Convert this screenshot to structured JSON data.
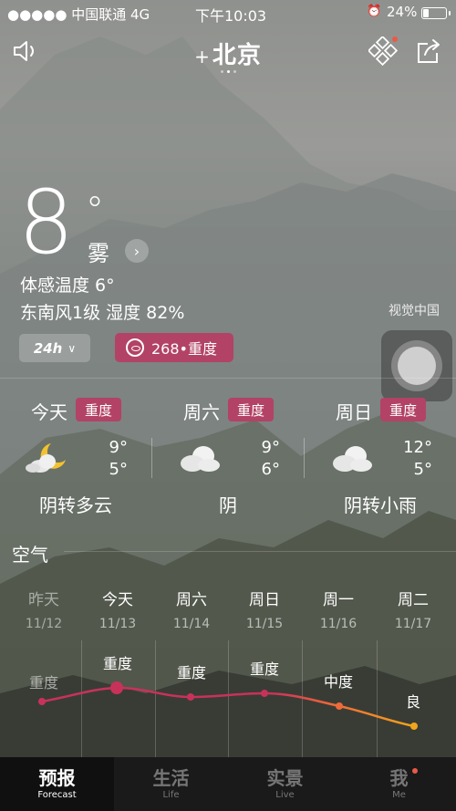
{
  "status_bar": {
    "carrier": "●●●●● 中国联通  4G",
    "time": "下午10:03",
    "alarm_icon": "alarm-icon",
    "battery_text": "24%",
    "battery_level": 0.24
  },
  "header": {
    "plus": "+",
    "city": "北京",
    "page_dots": 3,
    "active_dot": 1
  },
  "current": {
    "temp": "8",
    "degree": "°",
    "condition": "雾",
    "feels_like": "体感温度 6°",
    "wind_humidity": "东南风1级  湿度 82%",
    "photo_credit": "视觉中国",
    "period_button": "24h",
    "aqi_label": "268•重度"
  },
  "forecast": [
    {
      "day": "今天",
      "badge": "重度",
      "high": "9°",
      "low": "5°",
      "desc": "阴转多云",
      "icon": "moon-cloud-icon"
    },
    {
      "day": "周六",
      "badge": "重度",
      "high": "9°",
      "low": "6°",
      "desc": "阴",
      "icon": "cloud-icon"
    },
    {
      "day": "周日",
      "badge": "重度",
      "high": "12°",
      "low": "5°",
      "desc": "阴转小雨",
      "icon": "cloud-icon"
    }
  ],
  "air": {
    "title": "空气",
    "days": [
      {
        "weekday": "昨天",
        "date": "11/12",
        "level": "重度",
        "past": true
      },
      {
        "weekday": "今天",
        "date": "11/13",
        "level": "重度",
        "past": false
      },
      {
        "weekday": "周六",
        "date": "11/14",
        "level": "重度",
        "past": false
      },
      {
        "weekday": "周日",
        "date": "11/15",
        "level": "重度",
        "past": false
      },
      {
        "weekday": "周一",
        "date": "11/16",
        "level": "中度",
        "past": false
      },
      {
        "weekday": "周二",
        "date": "11/17",
        "level": "良",
        "past": false
      }
    ]
  },
  "tabs": [
    {
      "zh": "预报",
      "en": "Forecast",
      "active": true
    },
    {
      "zh": "生活",
      "en": "Life",
      "active": false
    },
    {
      "zh": "实景",
      "en": "Live",
      "active": false
    },
    {
      "zh": "我",
      "en": "Me",
      "active": false,
      "dot": true
    }
  ],
  "colors": {
    "badge": "#b24366",
    "line_heavy": "#c8325a",
    "line_moderate": "#ee6a3a",
    "line_good": "#f2a51a",
    "notify_dot": "#e95a47"
  }
}
